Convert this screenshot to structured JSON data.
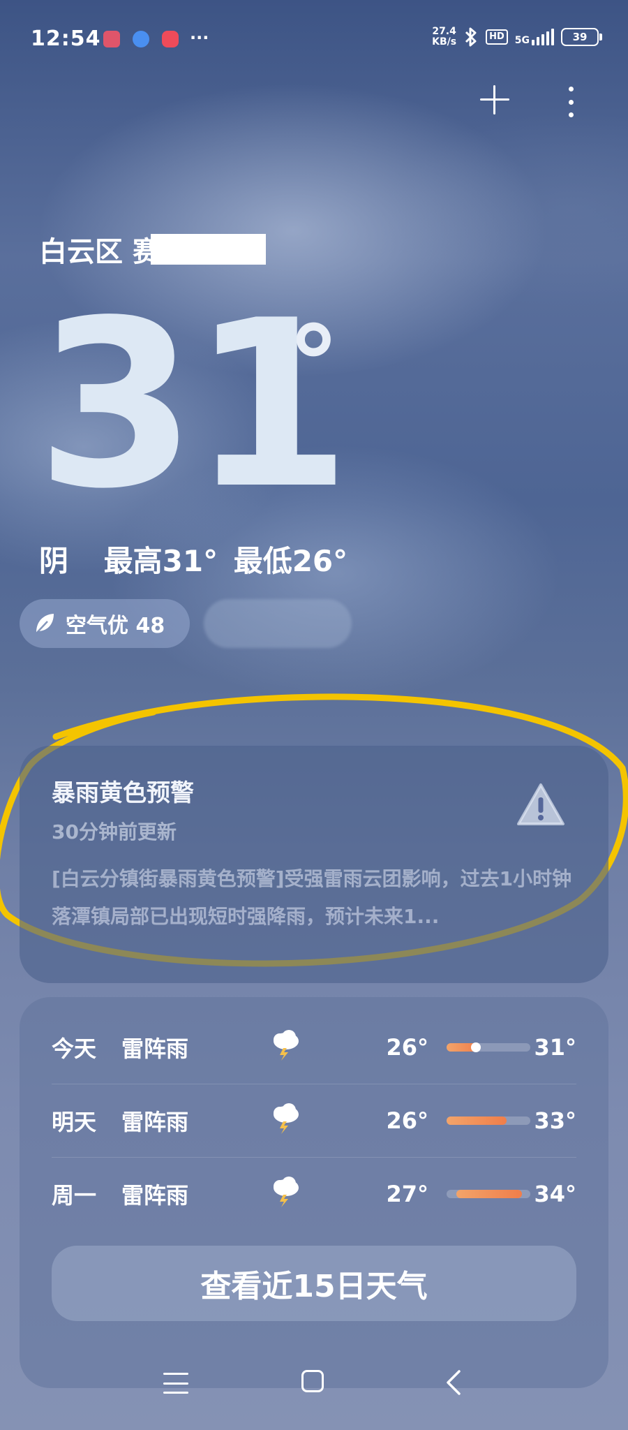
{
  "status_bar": {
    "time": "12:54",
    "more": "···",
    "net_speed_value": "27.4",
    "net_speed_unit": "KB/s",
    "hd": "HD",
    "network": "5G",
    "battery": "39",
    "notification_icons": [
      "app-notification-icon",
      "browser-notification-icon",
      "record-notification-icon"
    ]
  },
  "header": {
    "location": "白云区",
    "location_suffix_visible": "赛"
  },
  "current": {
    "temperature": "31",
    "degree": "°",
    "condition": "阴",
    "high_low": "最高31° 最低26°"
  },
  "pills": {
    "air_quality": "空气优 48"
  },
  "alert": {
    "title": "暴雨黄色预警",
    "updated": "30分钟前更新",
    "body": "[白云分镇街暴雨黄色预警]受强雷雨云团影响，过去1小时钟落潭镇局部已出现短时强降雨，预计未来1..."
  },
  "forecast": {
    "days": [
      {
        "day": "今天",
        "desc": "雷阵雨",
        "icon": "thunderstorm-icon",
        "low": "26°",
        "high": "31°",
        "range_start": 0.0,
        "range_end": 0.38,
        "current_marker": 0.35
      },
      {
        "day": "明天",
        "desc": "雷阵雨",
        "icon": "thunderstorm-icon",
        "low": "26°",
        "high": "33°",
        "range_start": 0.0,
        "range_end": 0.72
      },
      {
        "day": "周一",
        "desc": "雷阵雨",
        "icon": "thunderstorm-icon",
        "low": "27°",
        "high": "34°",
        "range_start": 0.12,
        "range_end": 0.9
      }
    ],
    "view_15_days": "查看近15日天气"
  },
  "colors": {
    "range_bar": "#f07e4a",
    "highlight_ring": "#f4c400"
  }
}
